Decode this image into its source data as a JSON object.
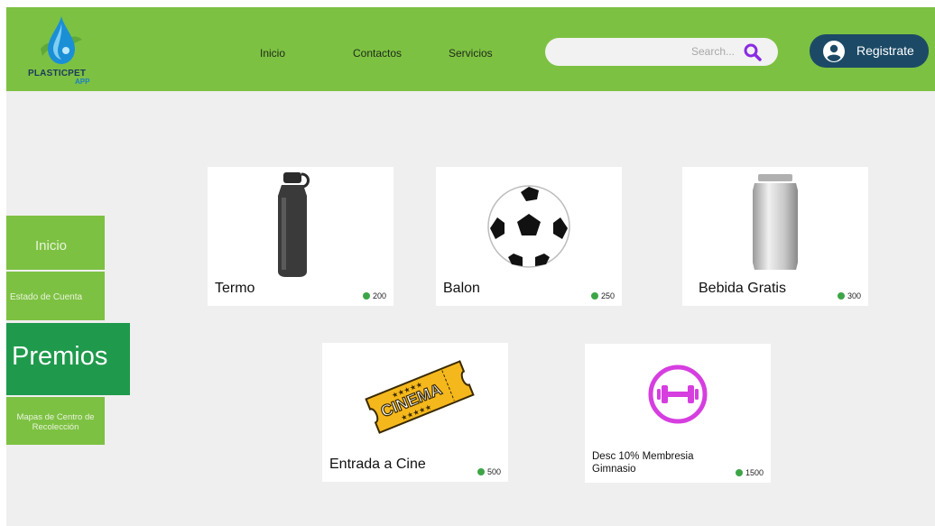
{
  "brand": {
    "name": "PLASTICPET",
    "sub": "APP"
  },
  "nav": {
    "items": [
      "Inicio",
      "Contactos",
      "Servicios"
    ]
  },
  "search": {
    "placeholder": "Search..."
  },
  "header": {
    "register_label": "Registrate"
  },
  "sidebar": {
    "items": [
      {
        "label": "Inicio"
      },
      {
        "label": "Estado de Cuenta"
      },
      {
        "label": "Premios",
        "active": true
      },
      {
        "label": "Mapas de Centro de Recolección"
      }
    ]
  },
  "prizes": [
    {
      "name": "Termo",
      "points": "200",
      "icon": "water-bottle-icon"
    },
    {
      "name": "Balon",
      "points": "250",
      "icon": "soccer-ball-icon"
    },
    {
      "name": "Bebida Gratis",
      "points": "300",
      "icon": "drink-can-icon"
    },
    {
      "name": "Entrada a Cine",
      "points": "500",
      "icon": "cinema-ticket-icon",
      "ticket_text": "CINEMA"
    },
    {
      "name": "Desc 10% Membresia Gimnasio",
      "points": "1500",
      "icon": "dumbbell-icon"
    }
  ],
  "colors": {
    "header": "#7dc142",
    "sidebar": "#7dc142",
    "sidebar_active": "#1f9a4c",
    "register_button": "#1c4a66",
    "accent_purple": "#8a2be2",
    "gym_magenta": "#d63ee0",
    "points_coin": "#3da547"
  }
}
